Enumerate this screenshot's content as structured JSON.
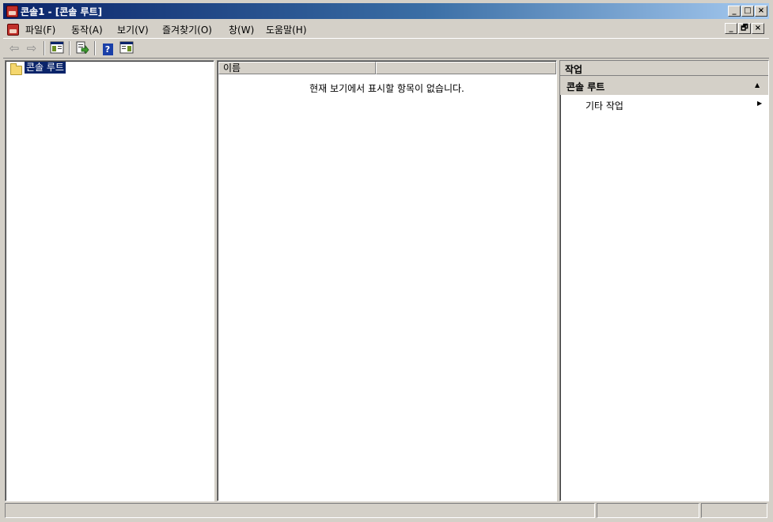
{
  "window": {
    "title": "콘솔1 - [콘솔 루트]",
    "minimize_glyph": "_",
    "maximize_glyph": "□",
    "restore_glyph": "🗗",
    "close_glyph": "×"
  },
  "menubar": {
    "items": [
      {
        "label": "파일(F)"
      },
      {
        "label": "동작(A)"
      },
      {
        "label": "보기(V)"
      },
      {
        "label": "즐겨찾기(O)"
      },
      {
        "label": "창(W)"
      },
      {
        "label": "도움말(H)"
      }
    ]
  },
  "toolbar": {
    "buttons": [
      "back-icon",
      "forward-icon",
      "show-hide-tree-icon",
      "export-list-icon",
      "help-icon",
      "show-hide-action-pane-icon"
    ],
    "back_glyph": "⇦",
    "forward_glyph": "⇨",
    "help_glyph": "?"
  },
  "tree": {
    "items": [
      {
        "label": "콘솔 루트",
        "selected": true,
        "icon": "folder-icon"
      }
    ]
  },
  "list": {
    "columns": [
      "이름",
      ""
    ],
    "empty_message": "현재 보기에서 표시할 항목이 없습니다."
  },
  "actions": {
    "header": "작업",
    "section_title": "콘솔 루트",
    "collapse_glyph": "▲",
    "items": [
      {
        "label": "기타 작업",
        "submenu_glyph": "▶"
      }
    ]
  },
  "colors": {
    "titlebar_start": "#0a246a",
    "titlebar_end": "#a6caf0",
    "selection": "#0a246a",
    "action_section_bg": "#d4d0c8"
  }
}
